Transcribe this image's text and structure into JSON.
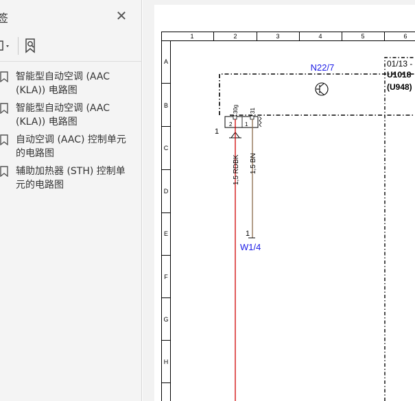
{
  "bookmarks_panel": {
    "title": "签",
    "close_label": "✕",
    "items": [
      {
        "label": "智能型自动空调 (AAC\n(KLA)) 电路图"
      },
      {
        "label": "智能型自动空调 (AAC\n(KLA)) 电路图"
      },
      {
        "label": "自动空调 (AAC) 控制单元\n的电路图"
      },
      {
        "label": "辅助加热器 (STH) 控制单\n元的电路图"
      }
    ]
  },
  "diagram": {
    "column_numbers": [
      "1",
      "2",
      "3",
      "4",
      "5",
      "6"
    ],
    "row_letters": [
      "A",
      "B",
      "C",
      "D",
      "E",
      "F",
      "G",
      "H"
    ],
    "component_ref": "N22/7",
    "side_block_lines": [
      "01/13 -",
      "U1018",
      "(U948)"
    ],
    "pin_30g": "30g",
    "pin_31": "31",
    "pin_2": "2",
    "pin_1": "1",
    "ground_num": "1",
    "wire_rdbk": "1,5 RDBK",
    "wire_bn": "1,5 BN",
    "connector_num": "1",
    "connector_ref": "W1/4",
    "colors": {
      "ref_blue": "#1a1ae6",
      "wire_red": "#d00000",
      "wire_brown": "#8a6a4a"
    }
  }
}
